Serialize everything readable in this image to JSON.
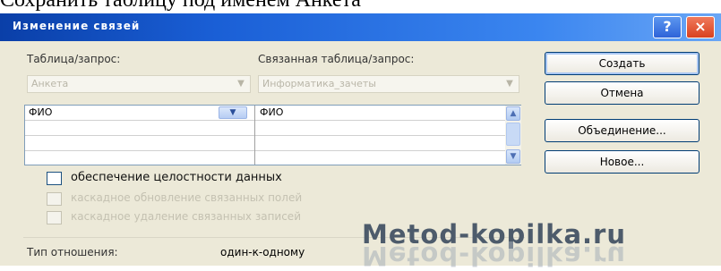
{
  "caption": "Сохранить таблицу под именем Анкета",
  "window": {
    "title": "Изменение связей",
    "help_glyph": "?",
    "close_glyph": "×"
  },
  "left_table": {
    "label": "Таблица/запрос:",
    "selected": "Анкета",
    "field": "ФИО"
  },
  "right_table": {
    "label": "Связанная таблица/запрос:",
    "selected": "Информатика_зачеты",
    "field": "ФИО"
  },
  "options": {
    "integrity": "обеспечение целостности данных",
    "cascade_update": "каскадное обновление связанных полей",
    "cascade_delete": "каскадное удаление связанных записей"
  },
  "relation": {
    "label": "Тип отношения:",
    "value": "один-к-одному"
  },
  "buttons": {
    "create": "Создать",
    "cancel": "Отмена",
    "join": "Объединение...",
    "new": "Новое..."
  },
  "watermark": "Metod-kopilka.ru",
  "icons": {
    "dropdown": "chevron-down-icon",
    "scroll_up": "scroll-up-icon",
    "scroll_down": "scroll-down-icon"
  }
}
